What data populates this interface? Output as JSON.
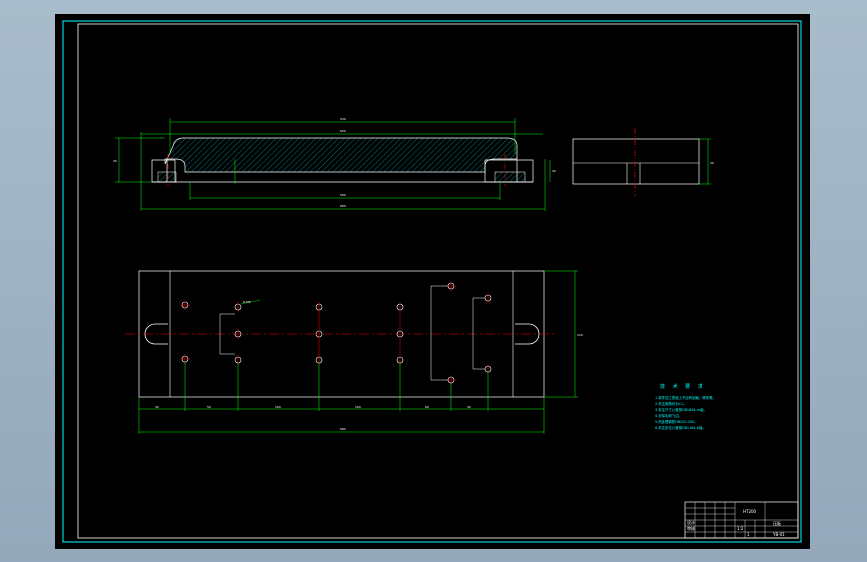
{
  "drawing": {
    "colors": {
      "viewport_bg": "#9fb3c4",
      "paper": "#000000",
      "frame": "#00ffff",
      "outline": "#ffffff",
      "dimension": "#00ff00",
      "centerline": "#ff0000",
      "hatch": "#00bfbf",
      "notes_text": "#00ffff"
    },
    "dimensions": {
      "top_overall": "600",
      "top_inner": "540",
      "bottom_overall": "680",
      "bottom_base": "560",
      "height_left": "40",
      "height_right": "40",
      "side_height": "20",
      "plan_height": "120",
      "plan_overall": "680",
      "chain_1": "40",
      "chain_2": "50",
      "chain_3": "160",
      "chain_4": "160",
      "chain_5": "60",
      "chain_6": "40",
      "callout": "6-M8"
    },
    "tech_notes": {
      "title": "技 术 要 求",
      "lines": [
        "1.零件加工表面上不应有划痕、擦伤等。",
        "2.未注倒角均为C1。",
        "3.未注尺寸公差按GB1804-m级。",
        "4.去除毛刺飞边。",
        "5.热处理调质HB220-250。",
        "6.未注形位公差按GB1184-K级。"
      ]
    },
    "title_block": {
      "material": "HT200",
      "part_name": "压板",
      "drawing_no": "YB-01",
      "scale": "1:2",
      "sheet": "1",
      "designer": "设计",
      "checker": "审核"
    }
  }
}
